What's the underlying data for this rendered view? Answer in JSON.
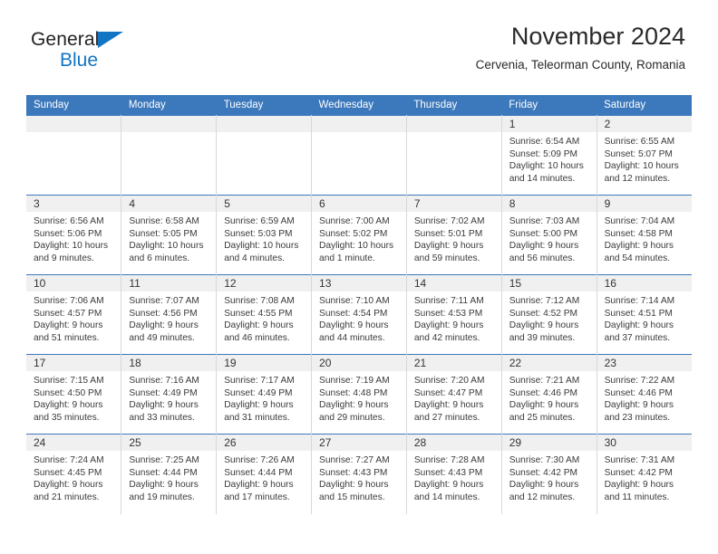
{
  "brand": {
    "line1": "General",
    "line2": "Blue",
    "triangle_color": "#1275c4"
  },
  "header": {
    "title": "November 2024",
    "location": "Cervenia, Teleorman County, Romania"
  },
  "theme": {
    "header_bg": "#3c78bc",
    "daynum_bg": "#f0f0f0",
    "text": "#3a3a3a",
    "cell_border": "#d8d8d8"
  },
  "labels": {
    "sunrise_prefix": "Sunrise:",
    "sunset_prefix": "Sunset:",
    "daylight_prefix": "Daylight:"
  },
  "weekdays": [
    "Sunday",
    "Monday",
    "Tuesday",
    "Wednesday",
    "Thursday",
    "Friday",
    "Saturday"
  ],
  "weeks": [
    [
      {
        "empty": true
      },
      {
        "empty": true
      },
      {
        "empty": true
      },
      {
        "empty": true
      },
      {
        "empty": true
      },
      {
        "day": "1",
        "sunrise": "Sunrise: 6:54 AM",
        "sunset": "Sunset: 5:09 PM",
        "daylight": "Daylight: 10 hours and 14 minutes."
      },
      {
        "day": "2",
        "sunrise": "Sunrise: 6:55 AM",
        "sunset": "Sunset: 5:07 PM",
        "daylight": "Daylight: 10 hours and 12 minutes."
      }
    ],
    [
      {
        "day": "3",
        "sunrise": "Sunrise: 6:56 AM",
        "sunset": "Sunset: 5:06 PM",
        "daylight": "Daylight: 10 hours and 9 minutes."
      },
      {
        "day": "4",
        "sunrise": "Sunrise: 6:58 AM",
        "sunset": "Sunset: 5:05 PM",
        "daylight": "Daylight: 10 hours and 6 minutes."
      },
      {
        "day": "5",
        "sunrise": "Sunrise: 6:59 AM",
        "sunset": "Sunset: 5:03 PM",
        "daylight": "Daylight: 10 hours and 4 minutes."
      },
      {
        "day": "6",
        "sunrise": "Sunrise: 7:00 AM",
        "sunset": "Sunset: 5:02 PM",
        "daylight": "Daylight: 10 hours and 1 minute."
      },
      {
        "day": "7",
        "sunrise": "Sunrise: 7:02 AM",
        "sunset": "Sunset: 5:01 PM",
        "daylight": "Daylight: 9 hours and 59 minutes."
      },
      {
        "day": "8",
        "sunrise": "Sunrise: 7:03 AM",
        "sunset": "Sunset: 5:00 PM",
        "daylight": "Daylight: 9 hours and 56 minutes."
      },
      {
        "day": "9",
        "sunrise": "Sunrise: 7:04 AM",
        "sunset": "Sunset: 4:58 PM",
        "daylight": "Daylight: 9 hours and 54 minutes."
      }
    ],
    [
      {
        "day": "10",
        "sunrise": "Sunrise: 7:06 AM",
        "sunset": "Sunset: 4:57 PM",
        "daylight": "Daylight: 9 hours and 51 minutes."
      },
      {
        "day": "11",
        "sunrise": "Sunrise: 7:07 AM",
        "sunset": "Sunset: 4:56 PM",
        "daylight": "Daylight: 9 hours and 49 minutes."
      },
      {
        "day": "12",
        "sunrise": "Sunrise: 7:08 AM",
        "sunset": "Sunset: 4:55 PM",
        "daylight": "Daylight: 9 hours and 46 minutes."
      },
      {
        "day": "13",
        "sunrise": "Sunrise: 7:10 AM",
        "sunset": "Sunset: 4:54 PM",
        "daylight": "Daylight: 9 hours and 44 minutes."
      },
      {
        "day": "14",
        "sunrise": "Sunrise: 7:11 AM",
        "sunset": "Sunset: 4:53 PM",
        "daylight": "Daylight: 9 hours and 42 minutes."
      },
      {
        "day": "15",
        "sunrise": "Sunrise: 7:12 AM",
        "sunset": "Sunset: 4:52 PM",
        "daylight": "Daylight: 9 hours and 39 minutes."
      },
      {
        "day": "16",
        "sunrise": "Sunrise: 7:14 AM",
        "sunset": "Sunset: 4:51 PM",
        "daylight": "Daylight: 9 hours and 37 minutes."
      }
    ],
    [
      {
        "day": "17",
        "sunrise": "Sunrise: 7:15 AM",
        "sunset": "Sunset: 4:50 PM",
        "daylight": "Daylight: 9 hours and 35 minutes."
      },
      {
        "day": "18",
        "sunrise": "Sunrise: 7:16 AM",
        "sunset": "Sunset: 4:49 PM",
        "daylight": "Daylight: 9 hours and 33 minutes."
      },
      {
        "day": "19",
        "sunrise": "Sunrise: 7:17 AM",
        "sunset": "Sunset: 4:49 PM",
        "daylight": "Daylight: 9 hours and 31 minutes."
      },
      {
        "day": "20",
        "sunrise": "Sunrise: 7:19 AM",
        "sunset": "Sunset: 4:48 PM",
        "daylight": "Daylight: 9 hours and 29 minutes."
      },
      {
        "day": "21",
        "sunrise": "Sunrise: 7:20 AM",
        "sunset": "Sunset: 4:47 PM",
        "daylight": "Daylight: 9 hours and 27 minutes."
      },
      {
        "day": "22",
        "sunrise": "Sunrise: 7:21 AM",
        "sunset": "Sunset: 4:46 PM",
        "daylight": "Daylight: 9 hours and 25 minutes."
      },
      {
        "day": "23",
        "sunrise": "Sunrise: 7:22 AM",
        "sunset": "Sunset: 4:46 PM",
        "daylight": "Daylight: 9 hours and 23 minutes."
      }
    ],
    [
      {
        "day": "24",
        "sunrise": "Sunrise: 7:24 AM",
        "sunset": "Sunset: 4:45 PM",
        "daylight": "Daylight: 9 hours and 21 minutes."
      },
      {
        "day": "25",
        "sunrise": "Sunrise: 7:25 AM",
        "sunset": "Sunset: 4:44 PM",
        "daylight": "Daylight: 9 hours and 19 minutes."
      },
      {
        "day": "26",
        "sunrise": "Sunrise: 7:26 AM",
        "sunset": "Sunset: 4:44 PM",
        "daylight": "Daylight: 9 hours and 17 minutes."
      },
      {
        "day": "27",
        "sunrise": "Sunrise: 7:27 AM",
        "sunset": "Sunset: 4:43 PM",
        "daylight": "Daylight: 9 hours and 15 minutes."
      },
      {
        "day": "28",
        "sunrise": "Sunrise: 7:28 AM",
        "sunset": "Sunset: 4:43 PM",
        "daylight": "Daylight: 9 hours and 14 minutes."
      },
      {
        "day": "29",
        "sunrise": "Sunrise: 7:30 AM",
        "sunset": "Sunset: 4:42 PM",
        "daylight": "Daylight: 9 hours and 12 minutes."
      },
      {
        "day": "30",
        "sunrise": "Sunrise: 7:31 AM",
        "sunset": "Sunset: 4:42 PM",
        "daylight": "Daylight: 9 hours and 11 minutes."
      }
    ]
  ]
}
